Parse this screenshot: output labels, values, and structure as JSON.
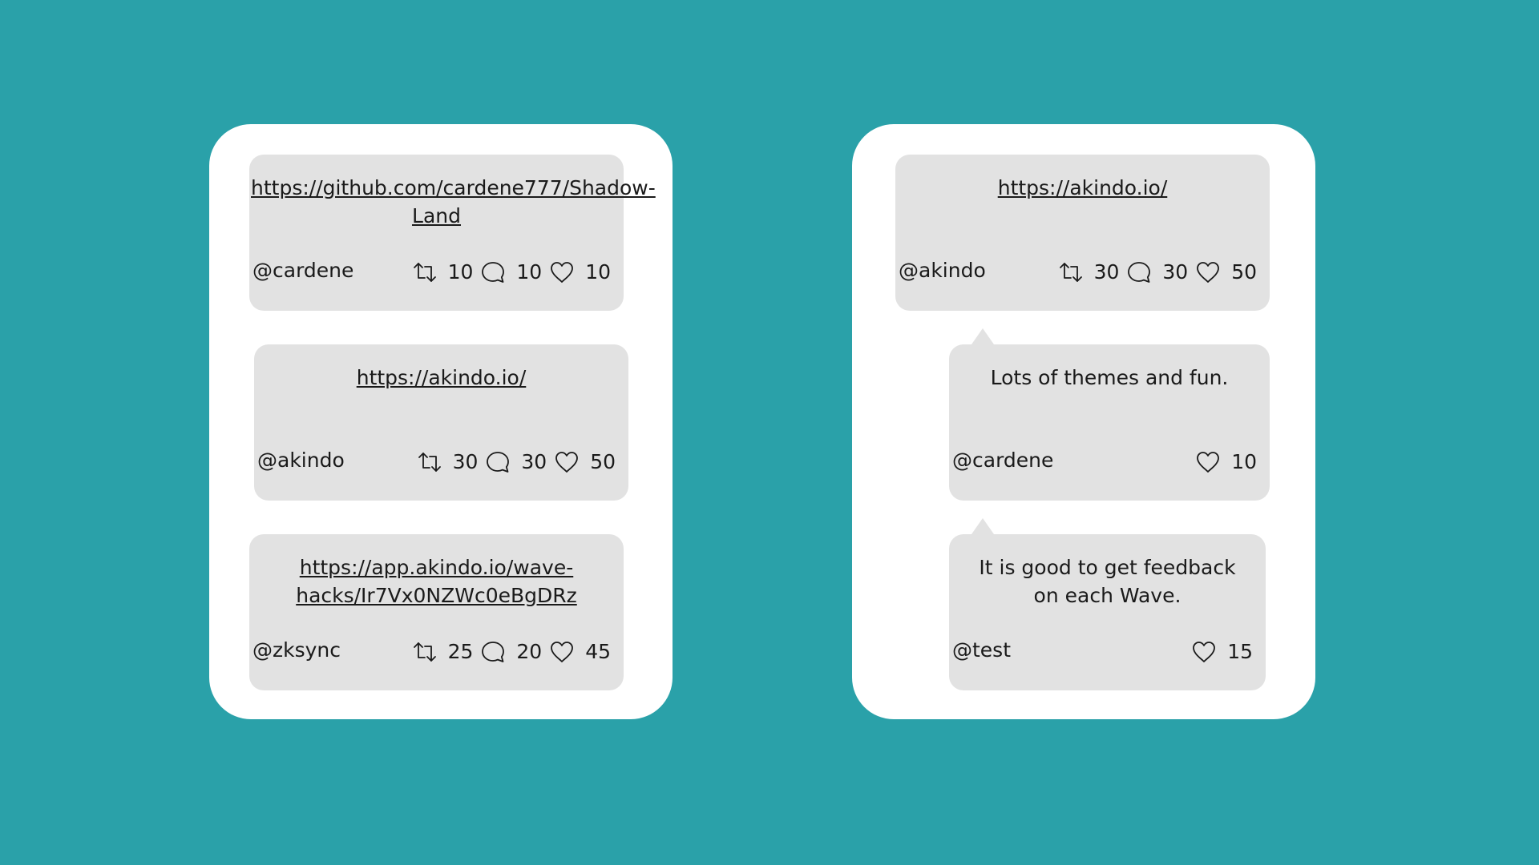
{
  "colors": {
    "background": "#2aa1a9",
    "panel": "#ffffff",
    "card": "#e2e2e2",
    "text": "#1a1a1a"
  },
  "left_panel": {
    "posts": [
      {
        "text": "https://github.com/cardene777/Shadow-Land",
        "handle": "@cardene",
        "retweets": "10",
        "comments": "10",
        "likes": "10"
      },
      {
        "text": "https://akindo.io/",
        "handle": "@akindo",
        "retweets": "30",
        "comments": "30",
        "likes": "50"
      },
      {
        "text": "https://app.akindo.io/wave-hacks/Ir7Vx0NZWc0eBgDRz",
        "handle": "@zksync",
        "retweets": "25",
        "comments": "20",
        "likes": "45"
      }
    ]
  },
  "right_panel": {
    "post": {
      "text": "https://akindo.io/",
      "handle": "@akindo",
      "retweets": "30",
      "comments": "30",
      "likes": "50"
    },
    "replies": [
      {
        "text": "Lots of themes and fun.",
        "handle": "@cardene",
        "likes": "10"
      },
      {
        "text": "It is good to get feedback on each Wave.",
        "handle": "@test",
        "likes": "15"
      }
    ]
  },
  "icons": {
    "retweet": "retweet-icon",
    "comment": "comment-icon",
    "like": "heart-icon"
  }
}
